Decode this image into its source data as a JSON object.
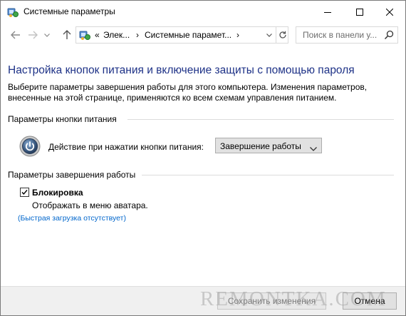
{
  "window": {
    "title": "Системные параметры",
    "title_icon": "control-panel-icon"
  },
  "caption": {
    "minimize_icon": "minimize-icon",
    "maximize_icon": "maximize-icon",
    "close_icon": "close-icon"
  },
  "nav": {
    "back_icon": "back-arrow-icon",
    "forward_icon": "forward-arrow-icon",
    "recent_icon": "chevron-down-icon",
    "up_icon": "up-arrow-icon",
    "address": {
      "overflow": "«",
      "crumb1": "Элек...",
      "separator": "›",
      "crumb2": "Системные парамет...",
      "separator2": "›"
    },
    "search_placeholder": "Поиск в панели у..."
  },
  "main": {
    "title": "Настройка кнопок питания и включение защиты с помощью пароля",
    "description": "Выберите параметры завершения работы для этого компьютера. Изменения параметров, внесенные на этой странице, применяются ко всем схемам управления питанием.",
    "power_section": {
      "heading": "Параметры кнопки питания",
      "action_label": "Действие при нажатии кнопки питания:",
      "action_value": "Завершение работы"
    },
    "shutdown_section": {
      "heading": "Параметры завершения работы",
      "lock_label": "Блокировка",
      "lock_checked": true,
      "lock_description": "Отображать в меню аватара.",
      "fast_startup_note": "(Быстрая загрузка отсутствует)"
    }
  },
  "footer": {
    "save_label": "Сохранить изменения",
    "cancel_label": "Отмена",
    "watermark": "REMONTKA.COM"
  },
  "colors": {
    "title_blue": "#1e3287",
    "link_blue": "#0066cc"
  }
}
